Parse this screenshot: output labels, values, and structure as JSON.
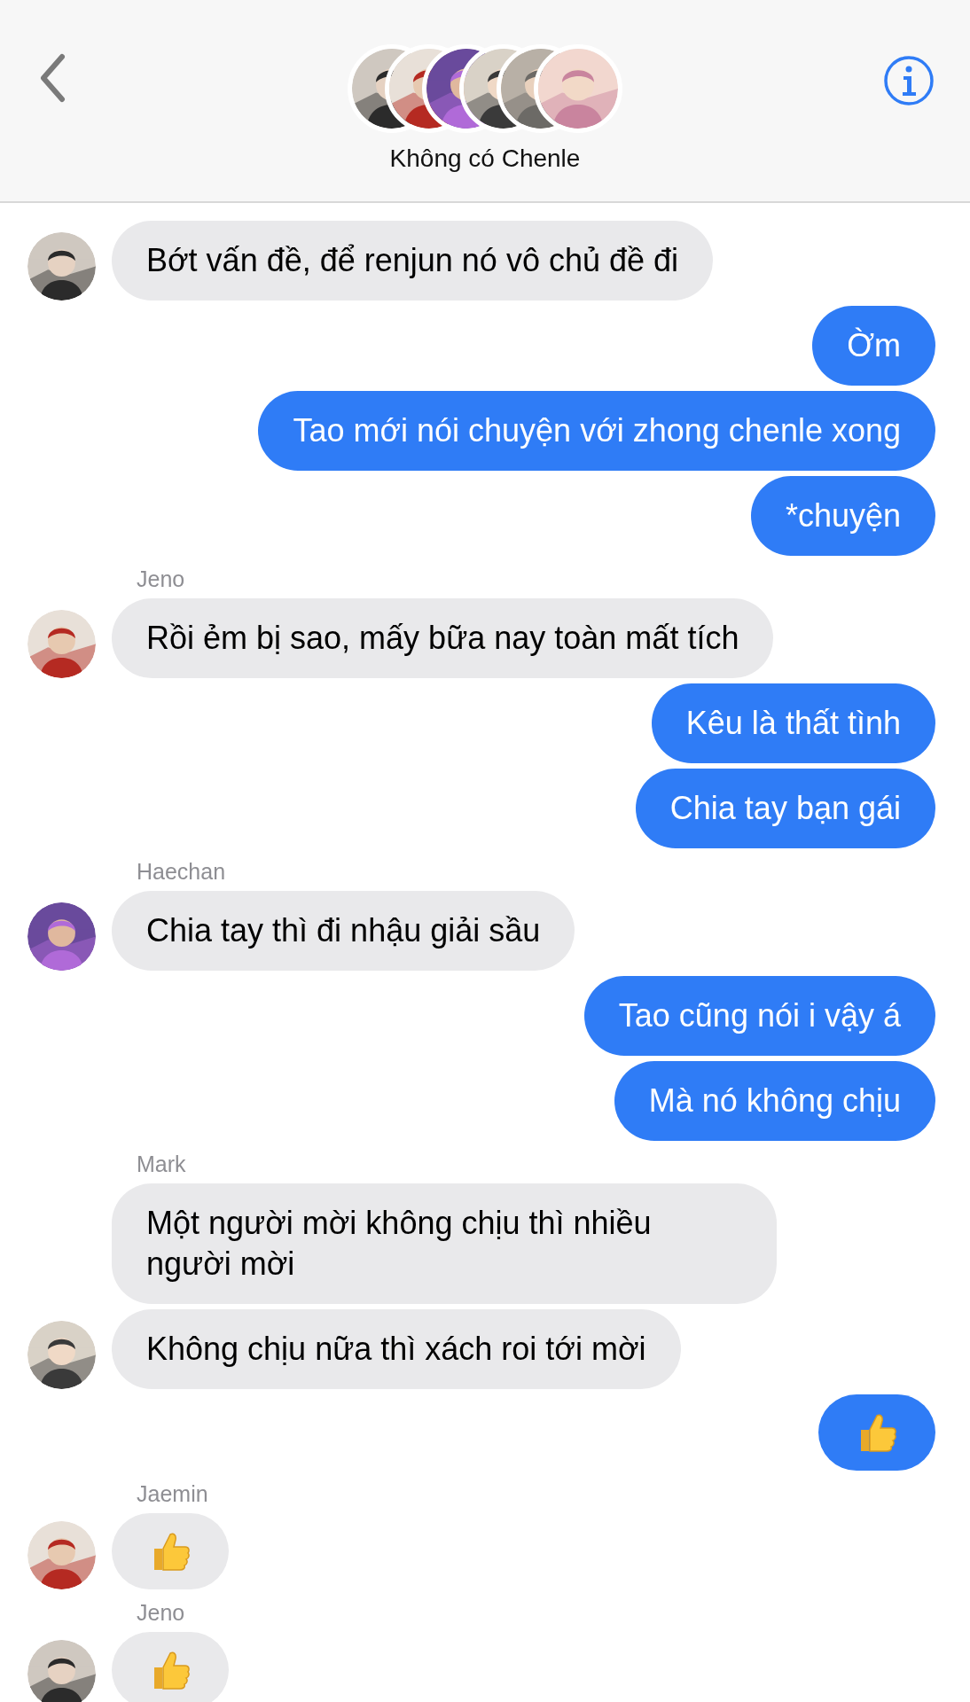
{
  "header": {
    "title": "Không có Chenle"
  },
  "groups": [
    {
      "kind": "incoming",
      "messages": [
        {
          "kind": "text",
          "text": "Bớt vấn đề, để renjun nó vô chủ đề đi"
        }
      ]
    },
    {
      "kind": "outgoing",
      "messages": [
        {
          "kind": "text",
          "text": "Ờm"
        },
        {
          "kind": "text",
          "text": "Tao mới nói chuyện với zhong chenle xong"
        },
        {
          "kind": "text",
          "text": "*chuyện"
        }
      ]
    },
    {
      "kind": "incoming",
      "sender": "Jeno",
      "messages": [
        {
          "kind": "text",
          "text": "Rồi ẻm bị sao, mấy bữa nay toàn mất tích"
        }
      ]
    },
    {
      "kind": "outgoing",
      "messages": [
        {
          "kind": "text",
          "text": "Kêu là thất tình"
        },
        {
          "kind": "text",
          "text": "Chia tay bạn gái"
        }
      ]
    },
    {
      "kind": "incoming",
      "sender": "Haechan",
      "messages": [
        {
          "kind": "text",
          "text": "Chia tay thì đi nhậu giải sầu"
        }
      ]
    },
    {
      "kind": "outgoing",
      "messages": [
        {
          "kind": "text",
          "text": "Tao cũng nói i vậy á"
        },
        {
          "kind": "text",
          "text": "Mà nó không chịu"
        }
      ]
    },
    {
      "kind": "incoming",
      "sender": "Mark",
      "messages": [
        {
          "kind": "text",
          "text": "Một người mời không chịu thì nhiều người mời"
        },
        {
          "kind": "text",
          "text": "Không chịu nữa thì xách roi tới mời"
        }
      ]
    },
    {
      "kind": "outgoing",
      "messages": [
        {
          "kind": "thumbs-up"
        }
      ]
    },
    {
      "kind": "incoming",
      "sender": "Jaemin",
      "messages": [
        {
          "kind": "thumbs-up"
        }
      ]
    },
    {
      "kind": "incoming",
      "sender": "Jeno",
      "messages": [
        {
          "kind": "thumbs-up"
        }
      ]
    }
  ]
}
